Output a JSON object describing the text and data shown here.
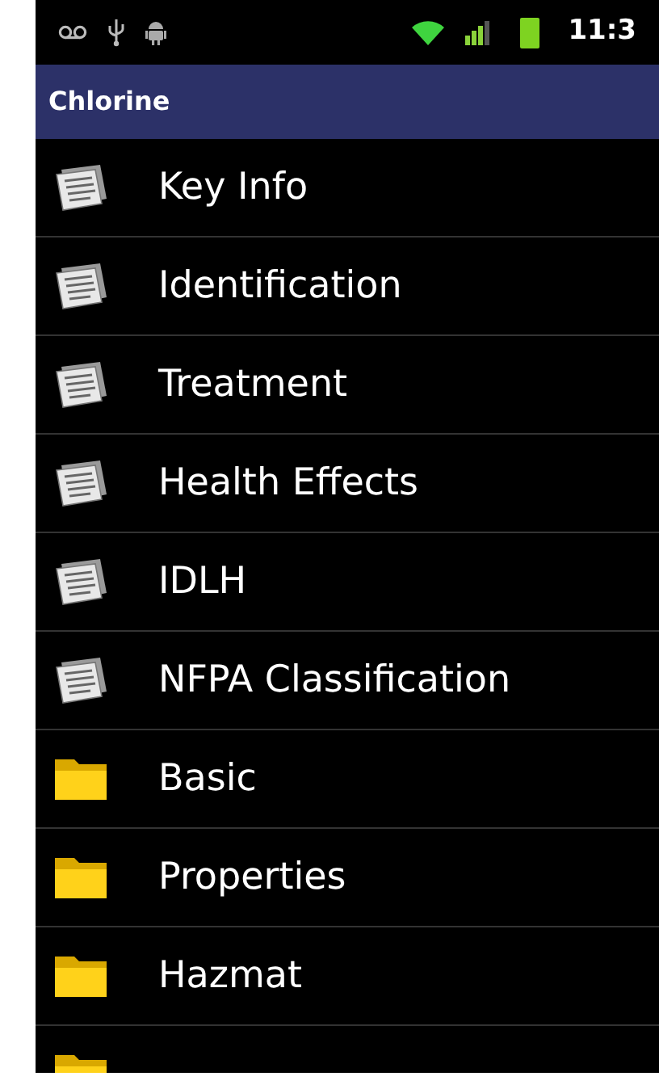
{
  "status_bar": {
    "time": "11:3"
  },
  "title_bar": {
    "title": "Chlorine"
  },
  "items": [
    {
      "kind": "document",
      "label": "Key Info"
    },
    {
      "kind": "document",
      "label": "Identification"
    },
    {
      "kind": "document",
      "label": "Treatment"
    },
    {
      "kind": "document",
      "label": "Health Effects"
    },
    {
      "kind": "document",
      "label": "IDLH"
    },
    {
      "kind": "document",
      "label": "NFPA Classification"
    },
    {
      "kind": "folder",
      "label": "Basic"
    },
    {
      "kind": "folder",
      "label": "Properties"
    },
    {
      "kind": "folder",
      "label": "Hazmat"
    },
    {
      "kind": "folder"
    }
  ]
}
